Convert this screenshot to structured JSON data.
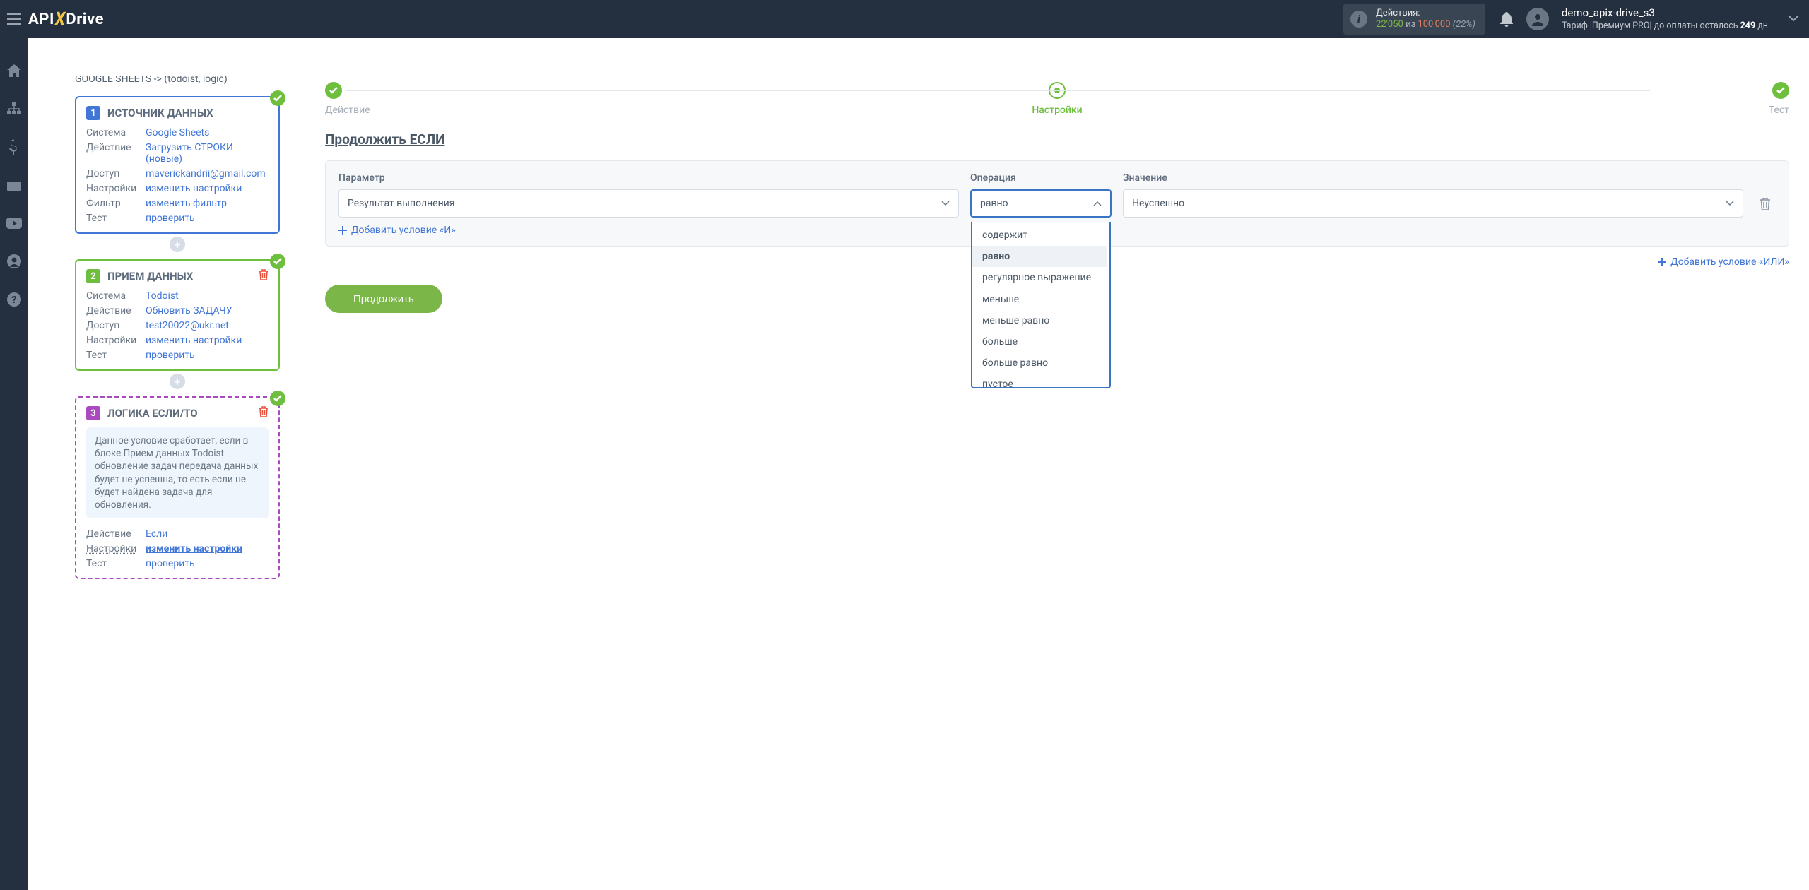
{
  "topbar": {
    "logo_pre": "API",
    "logo_post": "Drive",
    "actions_label": "Действия:",
    "actions_used": "22'050",
    "actions_of_word": "из",
    "actions_total": "100'000",
    "actions_pct": "(22%)",
    "user_name": "demo_apix-drive_s3",
    "tariff_prefix": "Тариф |Премиум PRO| до оплаты осталось ",
    "tariff_days": "249",
    "tariff_suffix": " дн"
  },
  "breadcrumb": "GOOGLE SHEETS -> (todoist, logic)",
  "block1": {
    "title": "ИСТОЧНИК ДАННЫХ",
    "rows": {
      "system_k": "Система",
      "system_v": "Google Sheets",
      "action_k": "Действие",
      "action_v": "Загрузить СТРОКИ (новые)",
      "access_k": "Доступ",
      "access_v": "maverickandrii@gmail.com",
      "settings_k": "Настройки",
      "settings_v": "изменить настройки",
      "filter_k": "Фильтр",
      "filter_v": "изменить фильтр",
      "test_k": "Тест",
      "test_v": "проверить"
    }
  },
  "block2": {
    "title": "ПРИЕМ ДАННЫХ",
    "rows": {
      "system_k": "Система",
      "system_v": "Todoist",
      "action_k": "Действие",
      "action_v": "Обновить ЗАДАЧУ",
      "access_k": "Доступ",
      "access_v": "test20022@ukr.net",
      "settings_k": "Настройки",
      "settings_v": "изменить настройки",
      "test_k": "Тест",
      "test_v": "проверить"
    }
  },
  "block3": {
    "title": "ЛОГИКА ЕСЛИ/ТО",
    "note": "Данное условие сработает, если в блоке Прием данных Todoist обновление задач передача данных будет не успешна, то есть если не будет найдена задача для обновления.",
    "rows": {
      "action_k": "Действие",
      "action_v": "Если",
      "settings_k": "Настройки",
      "settings_v": "изменить настройки",
      "test_k": "Тест",
      "test_v": "проверить"
    }
  },
  "stepper": {
    "s1": "Действие",
    "s2": "Настройки",
    "s3": "Тест"
  },
  "right": {
    "section_title": "Продолжить ЕСЛИ",
    "param_label": "Параметр",
    "op_label": "Операция",
    "val_label": "Значение",
    "param_value": "Результат выполнения",
    "op_value": "равно",
    "val_value": "Неуспешно",
    "add_and": "Добавить условие «И»",
    "add_or": "Добавить условие «ИЛИ»",
    "continue": "Продолжить"
  },
  "op_options": {
    "o0": "содержит",
    "o1": "равно",
    "o2": "регулярное выражение",
    "o3": "меньше",
    "o4": "меньше равно",
    "o5": "больше",
    "o6": "больше равно",
    "o7": "пустое"
  }
}
